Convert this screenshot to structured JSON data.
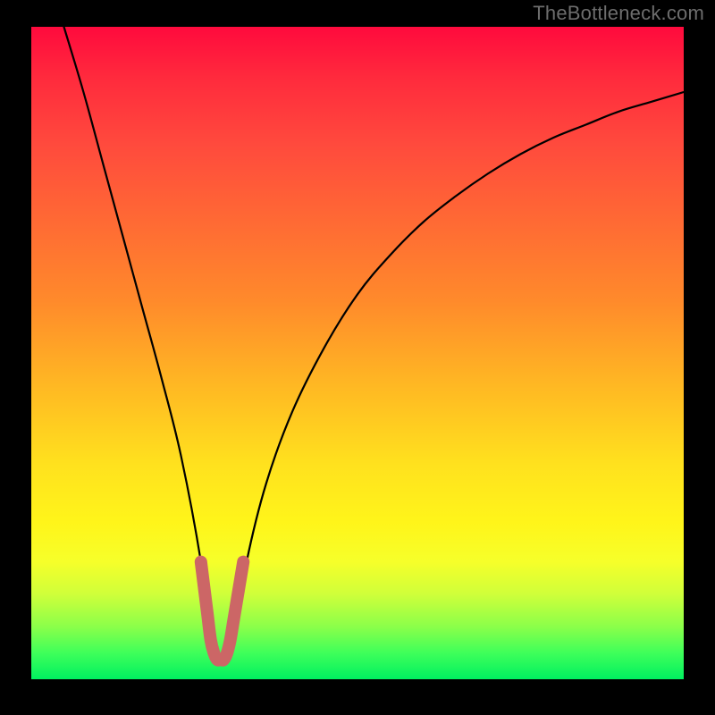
{
  "attribution": "TheBottleneck.com",
  "chart_data": {
    "type": "line",
    "title": "",
    "xlabel": "",
    "ylabel": "",
    "xlim": [
      0,
      100
    ],
    "ylim": [
      0,
      100
    ],
    "grid": false,
    "legend": false,
    "series": [
      {
        "name": "bottleneck-curve",
        "color": "#000000",
        "x": [
          5,
          8,
          11,
          14,
          17,
          20,
          23,
          26,
          27.5,
          29,
          30,
          31,
          33,
          36,
          40,
          45,
          50,
          55,
          60,
          65,
          70,
          75,
          80,
          85,
          90,
          95,
          100
        ],
        "y": [
          100,
          90,
          79,
          68,
          57,
          46,
          34,
          18,
          6,
          3,
          3,
          6,
          18,
          30,
          41,
          51,
          59,
          65,
          70,
          74,
          77.5,
          80.5,
          83,
          85,
          87,
          88.5,
          90
        ]
      },
      {
        "name": "valley-marker",
        "color": "#cc6666",
        "x": [
          26,
          26.5,
          27,
          27.5,
          28,
          28.5,
          29,
          29.5,
          30,
          30.5,
          31,
          31.5,
          32,
          32.5
        ],
        "y": [
          18,
          14,
          10,
          6,
          4,
          3,
          3,
          3,
          4,
          6,
          9,
          12,
          15,
          18
        ]
      }
    ],
    "background_gradient": {
      "direction": "vertical",
      "stops": [
        {
          "pos": 0.0,
          "color": "#ff0a3d"
        },
        {
          "pos": 0.18,
          "color": "#ff4a3d"
        },
        {
          "pos": 0.42,
          "color": "#ff8a2b"
        },
        {
          "pos": 0.67,
          "color": "#ffe11e"
        },
        {
          "pos": 0.82,
          "color": "#f6ff2a"
        },
        {
          "pos": 0.92,
          "color": "#8aff4a"
        },
        {
          "pos": 1.0,
          "color": "#00f060"
        }
      ]
    }
  }
}
